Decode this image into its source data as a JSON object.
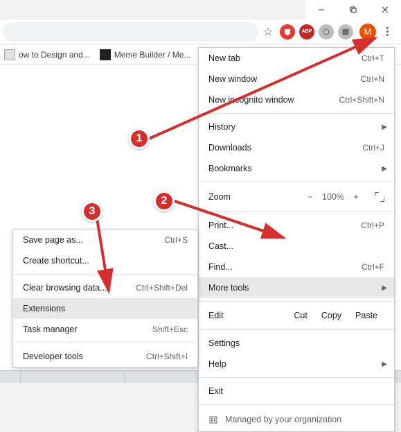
{
  "window": {
    "minimize": "—",
    "maximize": "❐",
    "close": "✕"
  },
  "toolbar": {
    "avatar_initial": "M",
    "ext_abp_label": "ABP"
  },
  "bookmarks": [
    {
      "label": "ow to Design and..."
    },
    {
      "label": "Meme Builder / Me..."
    }
  ],
  "menu": {
    "new_tab": {
      "label": "New tab",
      "shortcut": "Ctrl+T"
    },
    "new_window": {
      "label": "New window",
      "shortcut": "Ctrl+N"
    },
    "new_incognito": {
      "label": "New incognito window",
      "shortcut": "Ctrl+Shift+N"
    },
    "history": {
      "label": "History"
    },
    "downloads": {
      "label": "Downloads",
      "shortcut": "Ctrl+J"
    },
    "bookmarks": {
      "label": "Bookmarks"
    },
    "zoom": {
      "label": "Zoom",
      "minus": "−",
      "value": "100%",
      "plus": "+"
    },
    "print": {
      "label": "Print...",
      "shortcut": "Ctrl+P"
    },
    "cast": {
      "label": "Cast..."
    },
    "find": {
      "label": "Find...",
      "shortcut": "Ctrl+F"
    },
    "more_tools": {
      "label": "More tools"
    },
    "edit": {
      "label": "Edit",
      "cut": "Cut",
      "copy": "Copy",
      "paste": "Paste"
    },
    "settings": {
      "label": "Settings"
    },
    "help": {
      "label": "Help"
    },
    "exit": {
      "label": "Exit"
    },
    "managed": {
      "label": "Managed by your organization"
    }
  },
  "submenu": {
    "save_page": {
      "label": "Save page as...",
      "shortcut": "Ctrl+S"
    },
    "create_shortcut": {
      "label": "Create shortcut..."
    },
    "clear_browsing": {
      "label": "Clear browsing data...",
      "shortcut": "Ctrl+Shift+Del"
    },
    "extensions": {
      "label": "Extensions"
    },
    "task_manager": {
      "label": "Task manager",
      "shortcut": "Shift+Esc"
    },
    "developer_tools": {
      "label": "Developer tools",
      "shortcut": "Ctrl+Shift+I"
    }
  },
  "annotations": {
    "b1": "1",
    "b2": "2",
    "b3": "3"
  }
}
